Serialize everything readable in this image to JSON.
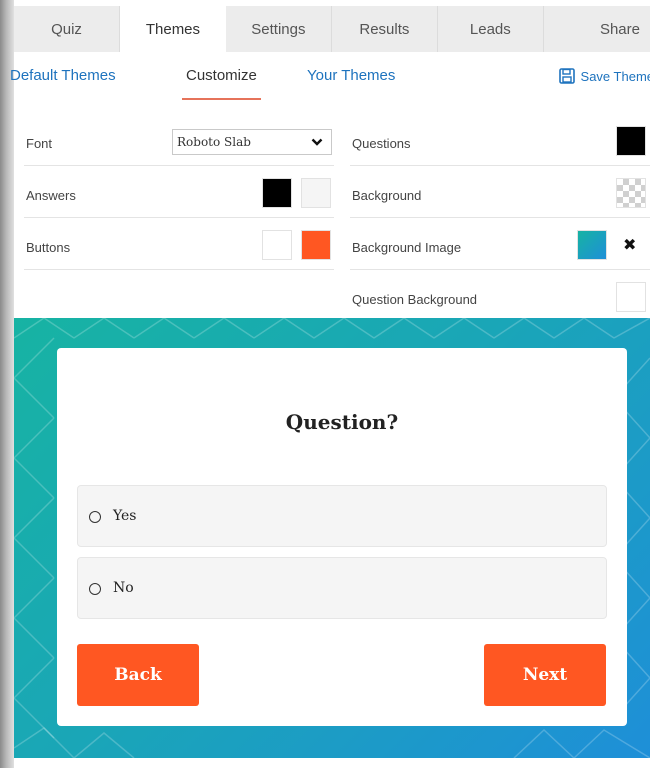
{
  "top_tabs": [
    {
      "label": "Quiz"
    },
    {
      "label": "Themes"
    },
    {
      "label": "Settings"
    },
    {
      "label": "Results"
    },
    {
      "label": "Leads"
    },
    {
      "label": "Share"
    }
  ],
  "active_top_tab": "Themes",
  "sub_tabs": [
    {
      "label": "Default Themes"
    },
    {
      "label": "Customize"
    },
    {
      "label": "Your Themes"
    }
  ],
  "active_sub_tab": "Customize",
  "save_theme_label": "Save Theme",
  "settings": {
    "font": {
      "label": "Font",
      "value": "Roboto Slab"
    },
    "answers": {
      "label": "Answers",
      "text_color": "#000000",
      "bg_color": "#f5f5f5"
    },
    "buttons": {
      "label": "Buttons",
      "text_color": "#ffffff",
      "bg_color": "#ff5722"
    },
    "questions": {
      "label": "Questions",
      "color": "#000000"
    },
    "background": {
      "label": "Background",
      "transparent": true
    },
    "background_image": {
      "label": "Background Image",
      "thumb_color": "#1aa6c5"
    },
    "question_background": {
      "label": "Question Background",
      "color": "#ffffff"
    }
  },
  "preview": {
    "question": "Question?",
    "answers": [
      {
        "label": "Yes"
      },
      {
        "label": "No"
      }
    ],
    "back_label": "Back",
    "next_label": "Next"
  },
  "colors": {
    "accent": "#1e73be",
    "button": "#ff5722",
    "tab_underline": "#e6735a",
    "preview_gradient_start": "#17b3a3",
    "preview_gradient_end": "#1e8fd8"
  },
  "icons": {
    "save": "floppy-disk-icon",
    "dropdown": "chevron-down-icon",
    "remove": "close-icon"
  }
}
